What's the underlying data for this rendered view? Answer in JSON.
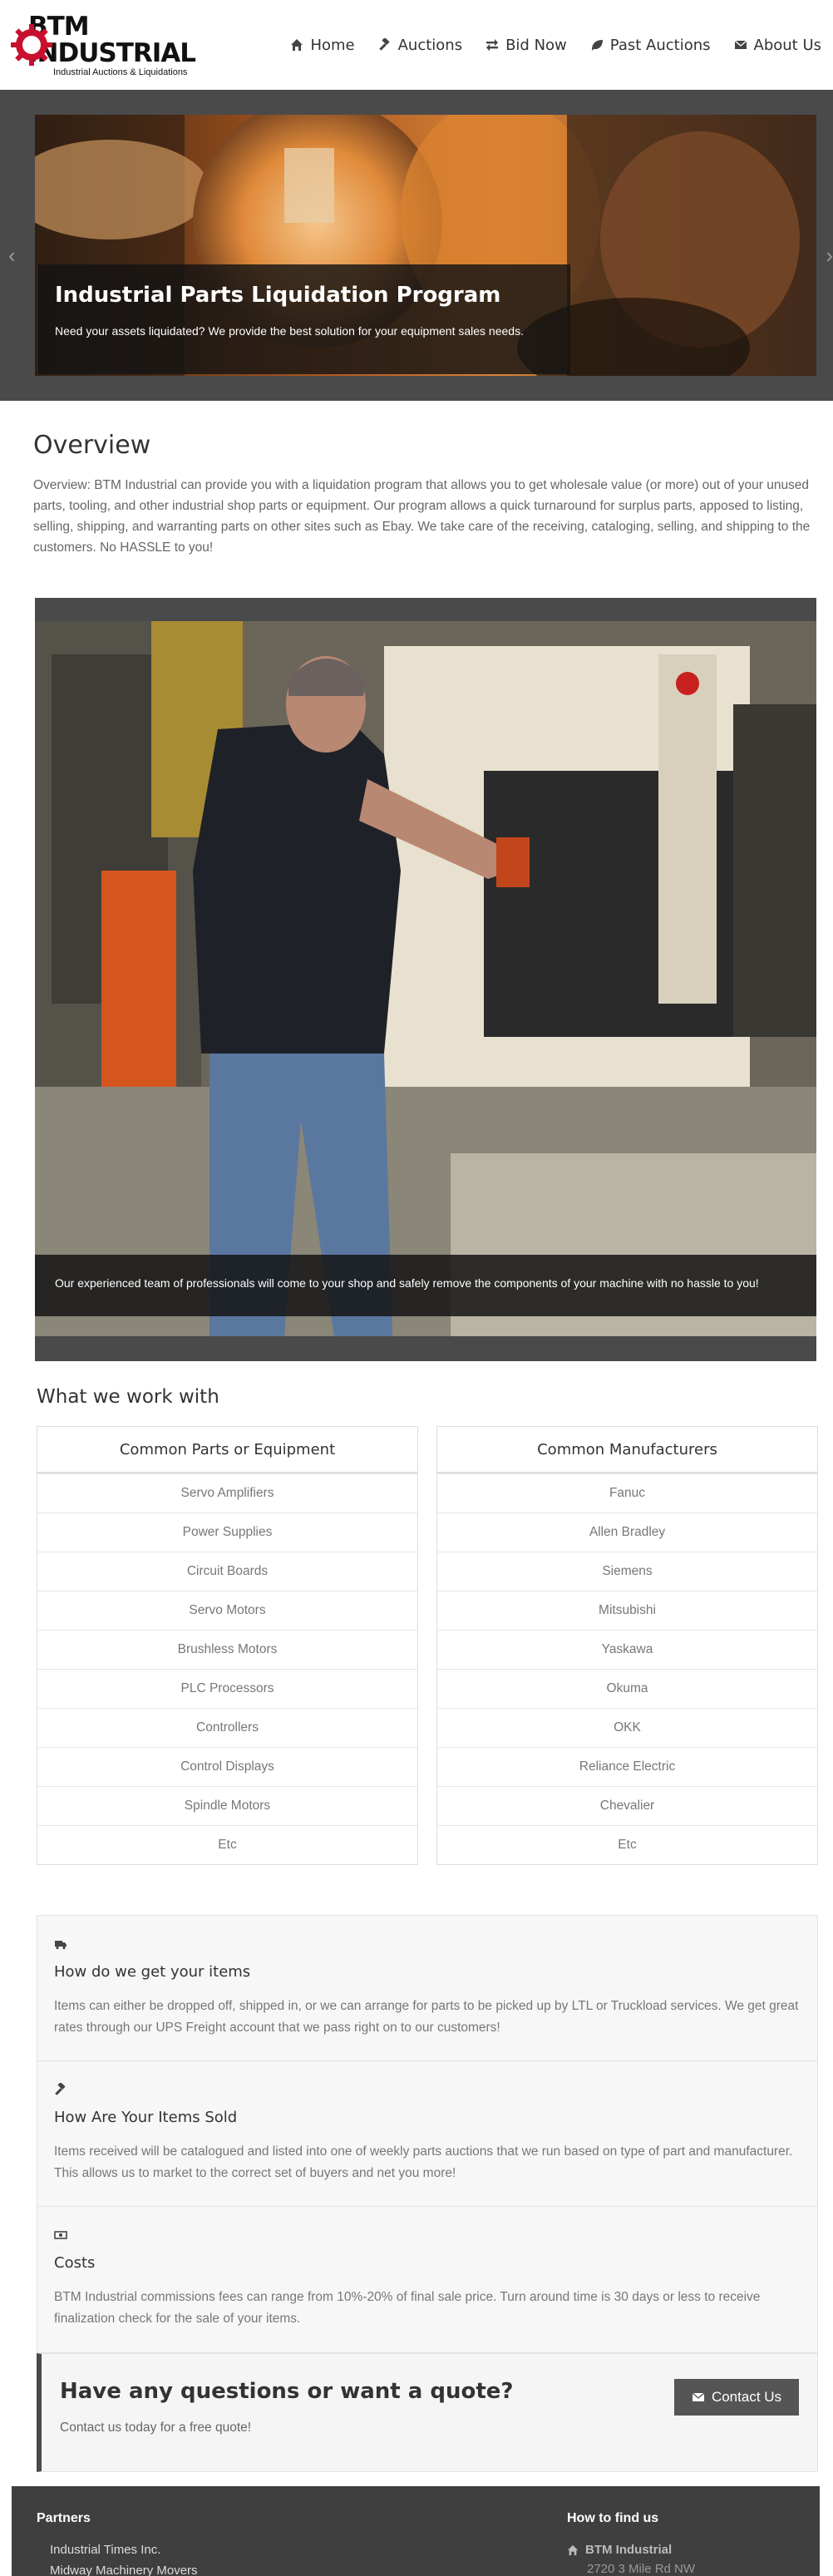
{
  "header": {
    "logo_title": "BTM INDUSTRIAL",
    "logo_subtitle": "Industrial Auctions & Liquidations",
    "nav": [
      {
        "label": "Home",
        "icon": "home-icon"
      },
      {
        "label": "Auctions",
        "icon": "gavel-icon"
      },
      {
        "label": "Bid Now",
        "icon": "exchange-icon"
      },
      {
        "label": "Past Auctions",
        "icon": "leaf-icon"
      },
      {
        "label": "About Us",
        "icon": "envelope-icon"
      }
    ]
  },
  "slider": {
    "title": "Industrial Parts Liquidation Program",
    "text": "Need your assets liquidated? We provide the best solution for your equipment sales needs."
  },
  "overview": {
    "title": "Overview",
    "text": "Overview: BTM Industrial can provide you with a liquidation program that allows you to get wholesale value (or more) out of your unused parts, tooling, and other industrial shop parts or equipment. Our program allows a quick turnaround for surplus parts, apposed to listing, selling, shipping, and warranting parts on other sites such as Ebay. We take care of the receiving, cataloging, selling, and shipping to the customers. No HASSLE to you!"
  },
  "photo": {
    "caption": "Our experienced team of professionals will come to your shop and safely remove the components of your machine with no hassle to you!"
  },
  "work_with": {
    "title": "What we work with",
    "parts": {
      "header": "Common Parts or Equipment",
      "items": [
        "Servo Amplifiers",
        "Power Supplies",
        "Circuit Boards",
        "Servo Motors",
        "Brushless Motors",
        "PLC Processors",
        "Controllers",
        "Control Displays",
        "Spindle Motors",
        "Etc"
      ]
    },
    "manufacturers": {
      "header": "Common Manufacturers",
      "items": [
        "Fanuc",
        "Allen Bradley",
        "Siemens",
        "Mitsubishi",
        "Yaskawa",
        "Okuma",
        "OKK",
        "Reliance Electric",
        "Chevalier",
        "Etc"
      ]
    }
  },
  "info": [
    {
      "icon": "truck-icon",
      "title": "How do we get your items",
      "text": "Items can either be dropped off, shipped in, or we can arrange for parts to be picked up by LTL or Truckload services. We get great rates through our UPS Freight account that we pass right on to our customers!"
    },
    {
      "icon": "gavel-icon",
      "title": "How Are Your Items Sold",
      "text": "Items received will be catalogued and listed into one of weekly parts auctions that we run based on type of part and manufacturer. This allows us to market to the correct set of buyers and net you more!"
    },
    {
      "icon": "money-icon",
      "title": "Costs",
      "text": "BTM Industrial commissions fees can range from 10%-20% of final sale price. Turn around time is 30 days or less to receive finalization check for the sale of your items."
    }
  ],
  "quote": {
    "title": "Have any questions or want a quote?",
    "text": "Contact us today for a free quote!",
    "button": "Contact Us"
  },
  "footer": {
    "partners_title": "Partners",
    "partners": [
      "Industrial Times Inc.",
      "Midway Machinery Movers"
    ],
    "find_title": "How to find us",
    "company": "BTM Industrial",
    "address": "2720 3 Mile Rd NW"
  },
  "colors": {
    "dark_band": "#4a4a4a",
    "footer_bg": "#3f3f3f",
    "logo_red": "#c8102e"
  }
}
